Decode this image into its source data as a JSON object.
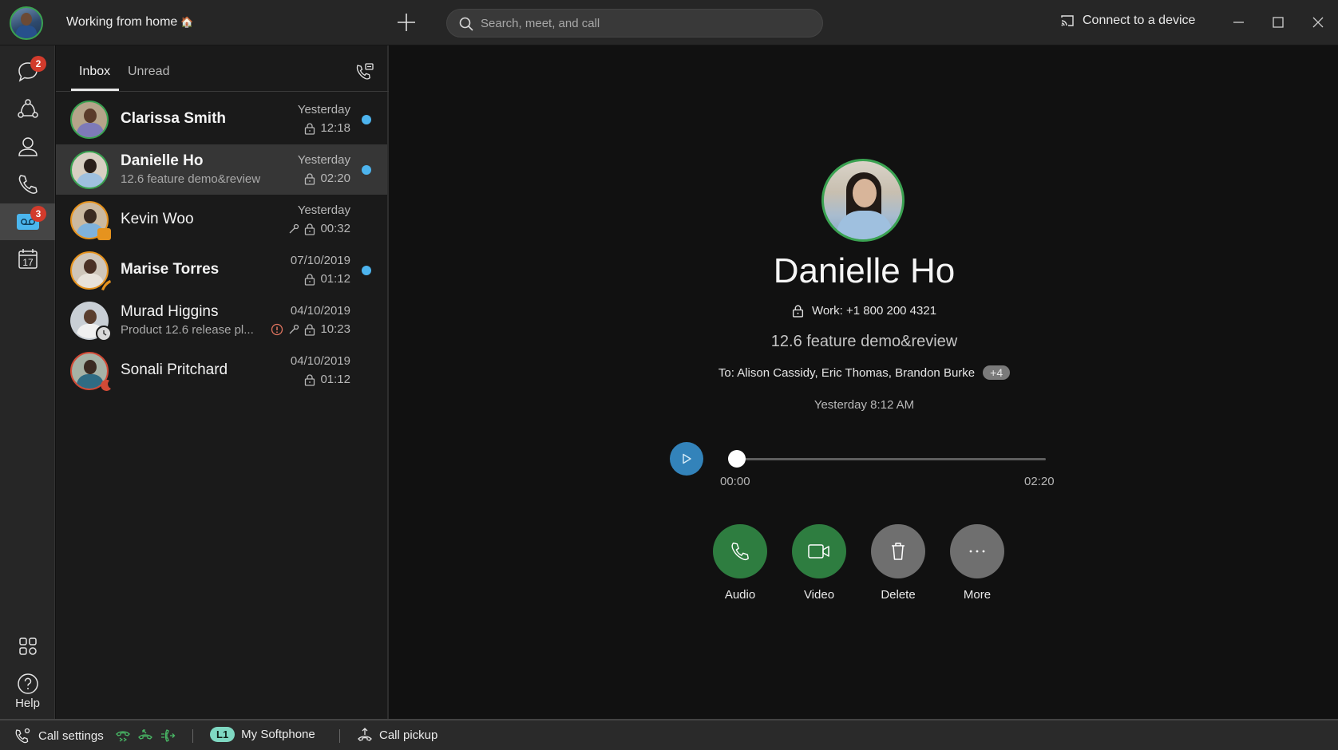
{
  "titlebar": {
    "status_text": "Working from home",
    "status_emoji": "🏠",
    "search_placeholder": "Search, meet, and call",
    "connect_label": "Connect to a device",
    "icons": {
      "new": "plus-icon",
      "search": "search-icon",
      "cast": "cast-icon",
      "minimize": "minimize-icon",
      "maximize": "maximize-icon",
      "close": "close-icon"
    }
  },
  "rail": {
    "items": [
      {
        "id": "messaging",
        "icon": "chat-bubble-icon",
        "badge": "2"
      },
      {
        "id": "teams",
        "icon": "teams-icon",
        "badge": ""
      },
      {
        "id": "contacts",
        "icon": "person-icon",
        "badge": ""
      },
      {
        "id": "calls",
        "icon": "phone-icon",
        "badge": ""
      },
      {
        "id": "voicemail",
        "icon": "voicemail-icon",
        "badge": "3",
        "active": true
      },
      {
        "id": "calendar",
        "icon": "calendar-icon",
        "badge": "",
        "day": "17"
      }
    ],
    "apps_icon": "apps-grid-icon",
    "help_label": "Help"
  },
  "list": {
    "tabs": [
      {
        "label": "Inbox",
        "active": true
      },
      {
        "label": "Unread",
        "active": false
      }
    ],
    "rows": [
      {
        "name": "Clarissa Smith",
        "subject": "",
        "date": "Yesterday",
        "duration": "12:18",
        "bold": true,
        "unread": true,
        "presence": "available",
        "urgent": false,
        "private": false
      },
      {
        "name": "Danielle Ho",
        "subject": "12.6 feature demo&review",
        "date": "Yesterday",
        "duration": "02:20",
        "bold": true,
        "unread": true,
        "presence": "available",
        "urgent": false,
        "private": false,
        "selected": true
      },
      {
        "name": "Kevin Woo",
        "subject": "",
        "date": "Yesterday",
        "duration": "00:32",
        "bold": false,
        "unread": false,
        "presence": "in-meeting",
        "urgent": false,
        "private": true
      },
      {
        "name": "Marise Torres",
        "subject": "",
        "date": "07/10/2019",
        "duration": "01:12",
        "bold": true,
        "unread": true,
        "presence": "on-call",
        "urgent": false,
        "private": false
      },
      {
        "name": "Murad Higgins",
        "subject": "Product 12.6 release pl...",
        "date": "04/10/2019",
        "duration": "10:23",
        "bold": false,
        "unread": false,
        "presence": "away",
        "urgent": true,
        "private": true
      },
      {
        "name": "Sonali Pritchard",
        "subject": "",
        "date": "04/10/2019",
        "duration": "01:12",
        "bold": false,
        "unread": false,
        "presence": "do-not-disturb",
        "urgent": false,
        "private": false
      }
    ]
  },
  "detail": {
    "name": "Danielle Ho",
    "phone": "Work: +1 800 200 4321",
    "subject": "12.6 feature demo&review",
    "recipients": "To: Alison Cassidy, Eric Thomas, Brandon Burke",
    "more_recipients": "+4",
    "timestamp": "Yesterday 8:12 AM",
    "player": {
      "current": "00:00",
      "total": "02:20",
      "progress": 0
    },
    "actions": [
      {
        "id": "audio",
        "label": "Audio",
        "icon": "phone-icon",
        "color": "green"
      },
      {
        "id": "video",
        "label": "Video",
        "icon": "video-camera-icon",
        "color": "green"
      },
      {
        "id": "delete",
        "label": "Delete",
        "icon": "trash-icon",
        "color": "gray"
      },
      {
        "id": "more",
        "label": "More",
        "icon": "more-dots-icon",
        "color": "gray"
      }
    ]
  },
  "statusbar": {
    "call_settings": "Call settings",
    "line_badge": "L1",
    "softphone": "My Softphone",
    "call_pickup": "Call pickup"
  },
  "colors": {
    "accent_blue": "#3383ba",
    "unread_dot": "#4db4ee",
    "available_green": "#3aa251",
    "action_green": "#2e7d40",
    "away_orange": "#e6931e",
    "dnd_red": "#d24a36",
    "badge_red": "#d23b2c",
    "line_pill": "#7fd8c2"
  }
}
